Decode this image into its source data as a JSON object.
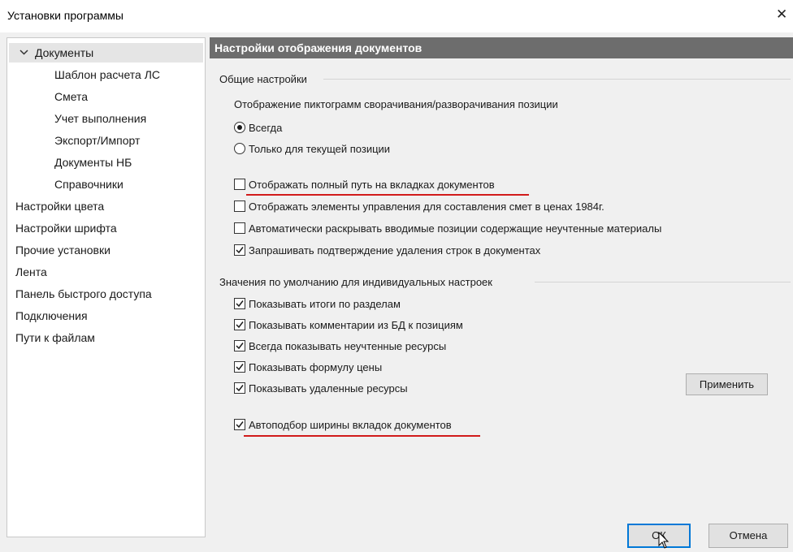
{
  "window": {
    "title": "Установки программы",
    "close_glyph": "✕"
  },
  "sidebar": {
    "items": [
      {
        "label": "Документы"
      },
      {
        "label": "Шаблон расчета ЛС"
      },
      {
        "label": "Смета"
      },
      {
        "label": "Учет выполнения"
      },
      {
        "label": "Экспорт/Импорт"
      },
      {
        "label": "Документы НБ"
      },
      {
        "label": "Справочники"
      },
      {
        "label": "Настройки цвета"
      },
      {
        "label": "Настройки шрифта"
      },
      {
        "label": "Прочие установки"
      },
      {
        "label": "Лента"
      },
      {
        "label": "Панель быстрого доступа"
      },
      {
        "label": "Подключения"
      },
      {
        "label": "Пути к файлам"
      }
    ]
  },
  "panel": {
    "header": "Настройки отображения документов",
    "general_group": "Общие настройки",
    "icons_label": "Отображение пиктограмм сворачивания/разворачивания позиции",
    "radios": [
      {
        "label": "Всегда",
        "checked": true
      },
      {
        "label": "Только для текущей позиции",
        "checked": false
      }
    ],
    "general_checks": [
      {
        "label": "Отображать полный путь на вкладках документов",
        "checked": false
      },
      {
        "label": "Отображать элементы управления для составления смет в ценах 1984г.",
        "checked": false
      },
      {
        "label": "Автоматически раскрывать вводимые позиции содержащие неучтенные материалы",
        "checked": false
      },
      {
        "label": "Запрашивать подтверждение удаления строк в документах",
        "checked": true
      }
    ],
    "defaults_group": "Значения по умолчанию для индивидуальных настроек",
    "default_checks": [
      {
        "label": "Показывать итоги по разделам",
        "checked": true
      },
      {
        "label": "Показывать комментарии из БД к позициям",
        "checked": true
      },
      {
        "label": "Всегда показывать неучтенные ресурсы",
        "checked": true
      },
      {
        "label": "Показывать формулу цены",
        "checked": true
      },
      {
        "label": "Показывать удаленные ресурсы",
        "checked": true
      },
      {
        "label": "Автоподбор ширины вкладок документов",
        "checked": true
      }
    ],
    "apply_label": "Применить"
  },
  "footer": {
    "ok_label": "ОК",
    "cancel_label": "Отмена"
  },
  "colors": {
    "header_bg": "#6d6d6d",
    "highlight": "#d11a1a",
    "selected": "#e5e5e5"
  }
}
